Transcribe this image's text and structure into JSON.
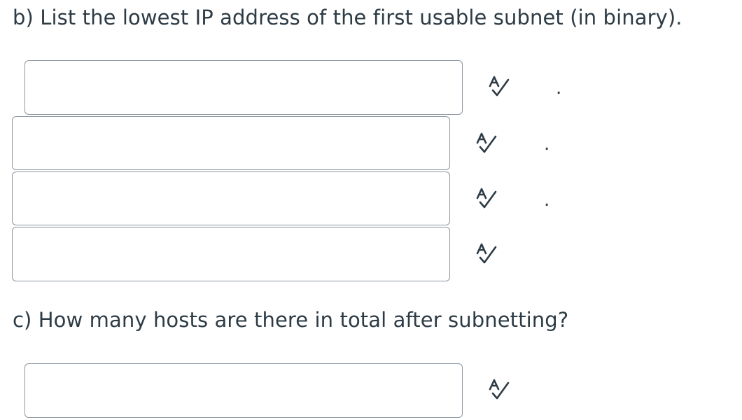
{
  "question_b": {
    "text": "b) List the lowest IP address of the first usable subnet (in binary).",
    "octets": [
      {
        "value": "",
        "separator": "."
      },
      {
        "value": "",
        "separator": "."
      },
      {
        "value": "",
        "separator": "."
      },
      {
        "value": ""
      }
    ],
    "icon": "spellcheck-icon"
  },
  "question_c": {
    "text": "c) How many hosts are there in total after subnetting?",
    "answer": {
      "value": ""
    },
    "icon": "spellcheck-icon"
  },
  "colors": {
    "text": "#2d3b45",
    "border": "#8c96a0",
    "background": "#ffffff"
  }
}
